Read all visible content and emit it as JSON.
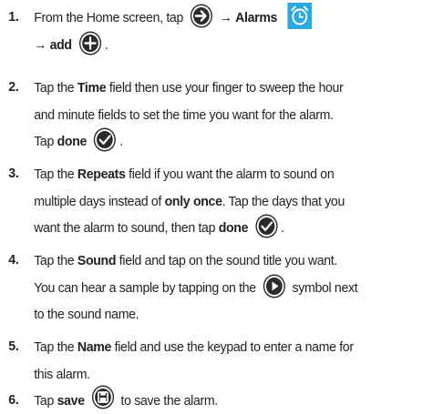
{
  "steps": [
    {
      "number": "1.",
      "t1": "From the Home screen, tap",
      "t2": "→",
      "t3": "Alarms",
      "t4": "→ add",
      "t5": ".",
      "icons": [
        "arrow-right-circle-icon",
        "alarm-clock-icon",
        "add-circle-icon"
      ]
    },
    {
      "number": "2.",
      "t1": "Tap the",
      "t2": "Time",
      "t3": "field then use your finger to sweep the hour",
      "t4": "and minute fields to set the time you want for the alarm.",
      "t5": "Tap",
      "t6": "done",
      "t7": ".",
      "icons": [
        "checkmark-circle-icon"
      ]
    },
    {
      "number": "3.",
      "t1": "Tap the",
      "t2": "Repeats",
      "t3": "field if you want the alarm to sound on",
      "t4": "multiple days instead of",
      "t5": "only once",
      "t6": ". Tap the days that you",
      "t7": "want the alarm to sound, then tap",
      "t8": "done",
      "t9": ".",
      "icons": [
        "checkmark-circle-icon"
      ]
    },
    {
      "number": "4.",
      "t1": "Tap the",
      "t2": "Sound",
      "t3": "field and tap on the sound title you want.",
      "t4": "You can hear a sample by tapping on the",
      "t5": "symbol next",
      "t6": "to the sound name.",
      "icons": [
        "play-circle-icon"
      ]
    },
    {
      "number": "5.",
      "t1": "Tap the",
      "t2": "Name",
      "t3": "field and use the keypad to enter a name for",
      "t4": "this alarm."
    },
    {
      "number": "6.",
      "t1": "Tap",
      "t2": "save",
      "t3": "to save the alarm.",
      "icons": [
        "save-circle-icon"
      ]
    }
  ],
  "colors": {
    "text": "#222222",
    "icon_dark": "#2b2b2b",
    "alarm_icon": "#29a9df"
  }
}
